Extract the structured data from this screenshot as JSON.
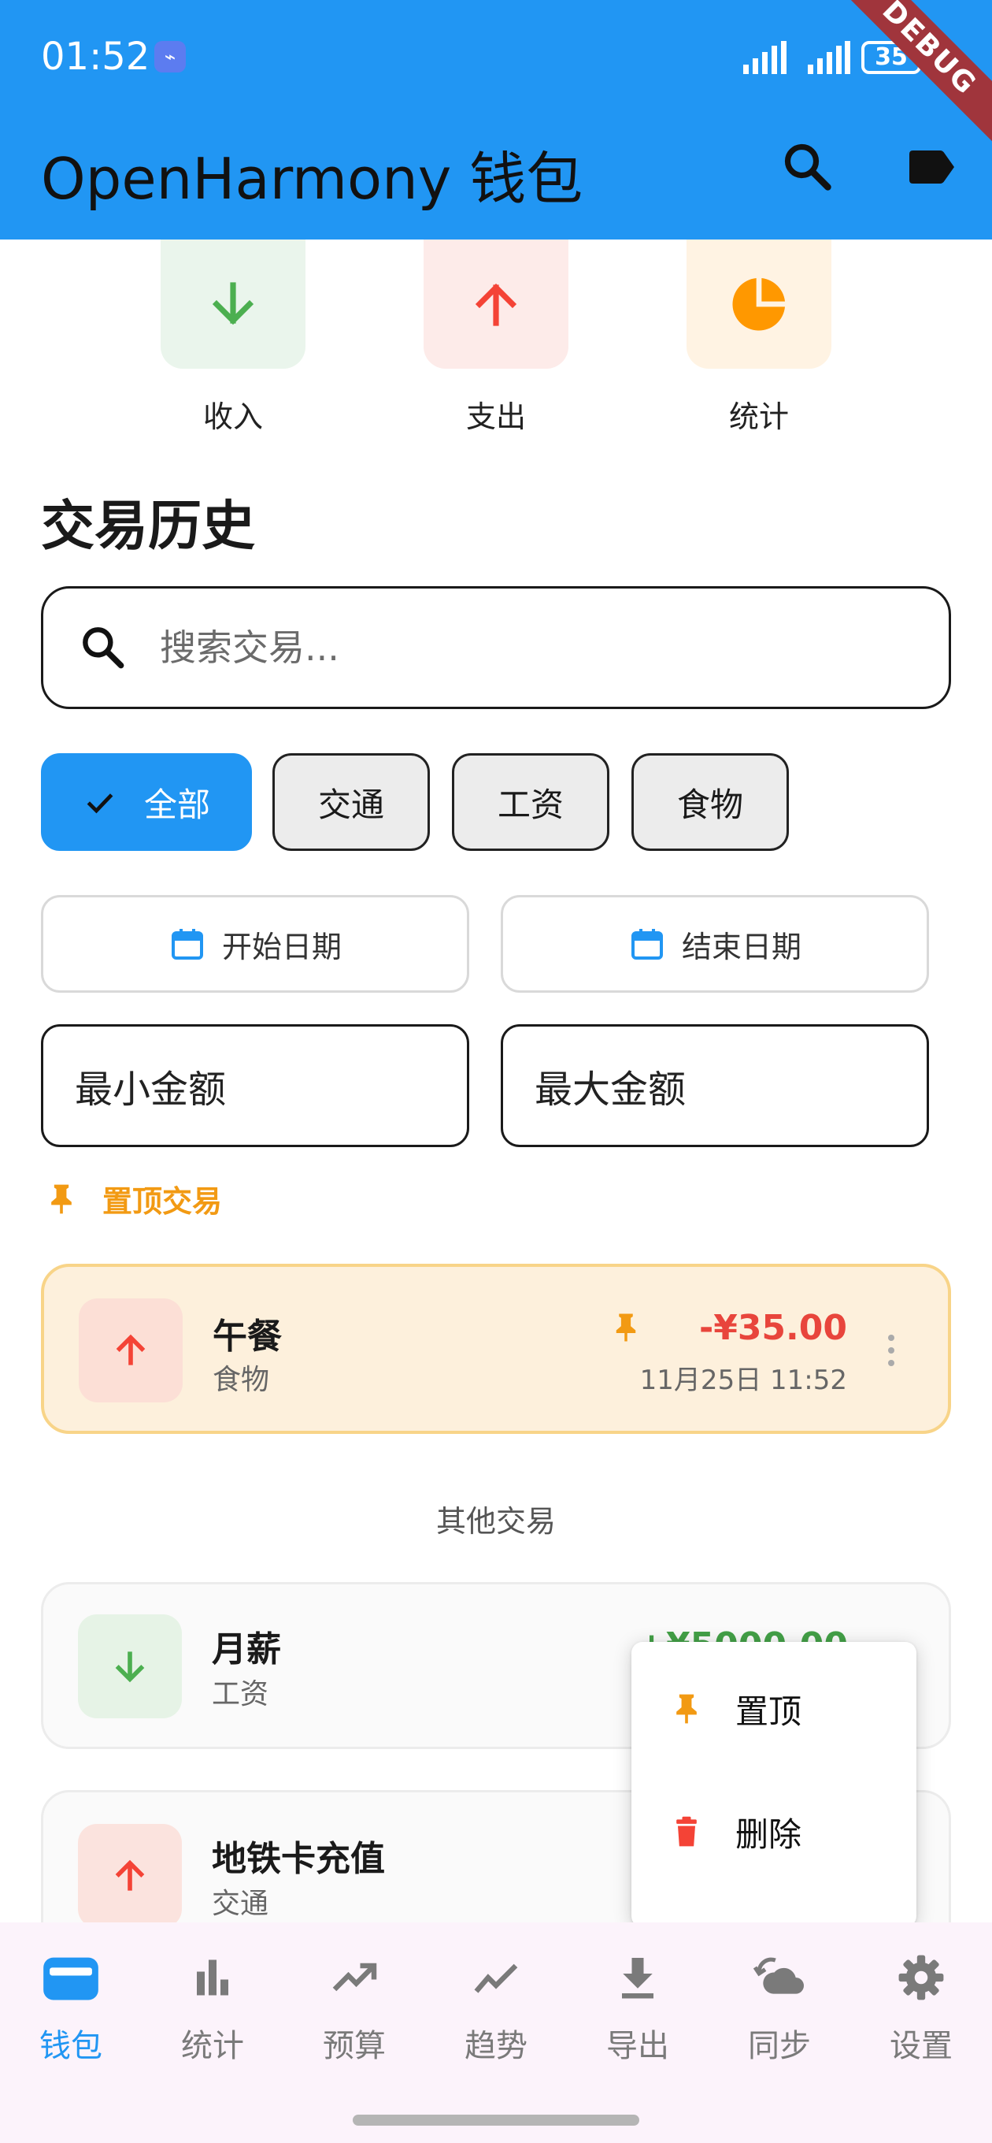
{
  "status_bar": {
    "time": "01:52",
    "battery": "35"
  },
  "app_bar": {
    "title": "OpenHarmony 钱包",
    "debug_label": "DEBUG"
  },
  "quick_actions": [
    {
      "label": "收入",
      "icon": "arrow-down-icon",
      "color": "#4caf50"
    },
    {
      "label": "支出",
      "icon": "arrow-up-icon",
      "color": "#f44336"
    },
    {
      "label": "统计",
      "icon": "pie-chart-icon",
      "color": "#ff9800"
    }
  ],
  "history": {
    "title": "交易历史",
    "search_placeholder": "搜索交易...",
    "filters": [
      {
        "label": "全部",
        "selected": true
      },
      {
        "label": "交通",
        "selected": false
      },
      {
        "label": "工资",
        "selected": false
      },
      {
        "label": "食物",
        "selected": false
      }
    ],
    "start_date": "开始日期",
    "end_date": "结束日期",
    "min_amount": "最小金额",
    "max_amount": "最大金额",
    "pinned_header": "置顶交易",
    "other_header": "其他交易"
  },
  "pinned_transactions": [
    {
      "name": "午餐",
      "category": "食物",
      "amount": "-¥35.00",
      "date": "11月25日 11:52",
      "type": "expense"
    }
  ],
  "transactions": [
    {
      "name": "月薪",
      "category": "工资",
      "amount": "+¥5000.00",
      "type": "income"
    },
    {
      "name": "地铁卡充值",
      "category": "交通",
      "type": "expense"
    }
  ],
  "context_menu": {
    "pin": "置顶",
    "delete": "删除"
  },
  "bottom_nav": [
    {
      "label": "钱包",
      "icon": "wallet-icon",
      "active": true
    },
    {
      "label": "统计",
      "icon": "bar-chart-icon",
      "active": false
    },
    {
      "label": "预算",
      "icon": "trending-up-icon",
      "active": false
    },
    {
      "label": "趋势",
      "icon": "trend-line-icon",
      "active": false
    },
    {
      "label": "导出",
      "icon": "download-icon",
      "active": false
    },
    {
      "label": "同步",
      "icon": "sync-icon",
      "active": false
    },
    {
      "label": "设置",
      "icon": "settings-icon",
      "active": false
    }
  ],
  "colors": {
    "primary": "#2196f3",
    "income": "#4caf50",
    "expense": "#f44336",
    "pinned": "#f29a13"
  }
}
